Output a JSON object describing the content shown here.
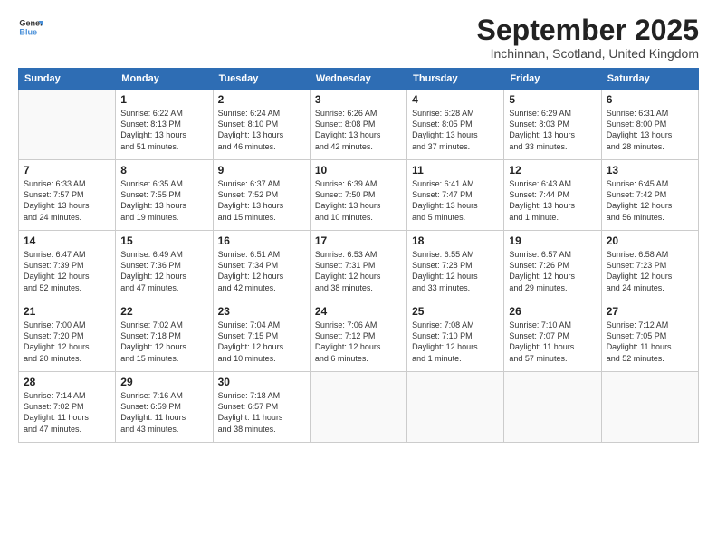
{
  "header": {
    "logo_line1": "General",
    "logo_line2": "Blue",
    "month_title": "September 2025",
    "location": "Inchinnan, Scotland, United Kingdom"
  },
  "days_of_week": [
    "Sunday",
    "Monday",
    "Tuesday",
    "Wednesday",
    "Thursday",
    "Friday",
    "Saturday"
  ],
  "weeks": [
    [
      {
        "day": "",
        "info": ""
      },
      {
        "day": "1",
        "info": "Sunrise: 6:22 AM\nSunset: 8:13 PM\nDaylight: 13 hours\nand 51 minutes."
      },
      {
        "day": "2",
        "info": "Sunrise: 6:24 AM\nSunset: 8:10 PM\nDaylight: 13 hours\nand 46 minutes."
      },
      {
        "day": "3",
        "info": "Sunrise: 6:26 AM\nSunset: 8:08 PM\nDaylight: 13 hours\nand 42 minutes."
      },
      {
        "day": "4",
        "info": "Sunrise: 6:28 AM\nSunset: 8:05 PM\nDaylight: 13 hours\nand 37 minutes."
      },
      {
        "day": "5",
        "info": "Sunrise: 6:29 AM\nSunset: 8:03 PM\nDaylight: 13 hours\nand 33 minutes."
      },
      {
        "day": "6",
        "info": "Sunrise: 6:31 AM\nSunset: 8:00 PM\nDaylight: 13 hours\nand 28 minutes."
      }
    ],
    [
      {
        "day": "7",
        "info": "Sunrise: 6:33 AM\nSunset: 7:57 PM\nDaylight: 13 hours\nand 24 minutes."
      },
      {
        "day": "8",
        "info": "Sunrise: 6:35 AM\nSunset: 7:55 PM\nDaylight: 13 hours\nand 19 minutes."
      },
      {
        "day": "9",
        "info": "Sunrise: 6:37 AM\nSunset: 7:52 PM\nDaylight: 13 hours\nand 15 minutes."
      },
      {
        "day": "10",
        "info": "Sunrise: 6:39 AM\nSunset: 7:50 PM\nDaylight: 13 hours\nand 10 minutes."
      },
      {
        "day": "11",
        "info": "Sunrise: 6:41 AM\nSunset: 7:47 PM\nDaylight: 13 hours\nand 5 minutes."
      },
      {
        "day": "12",
        "info": "Sunrise: 6:43 AM\nSunset: 7:44 PM\nDaylight: 13 hours\nand 1 minute."
      },
      {
        "day": "13",
        "info": "Sunrise: 6:45 AM\nSunset: 7:42 PM\nDaylight: 12 hours\nand 56 minutes."
      }
    ],
    [
      {
        "day": "14",
        "info": "Sunrise: 6:47 AM\nSunset: 7:39 PM\nDaylight: 12 hours\nand 52 minutes."
      },
      {
        "day": "15",
        "info": "Sunrise: 6:49 AM\nSunset: 7:36 PM\nDaylight: 12 hours\nand 47 minutes."
      },
      {
        "day": "16",
        "info": "Sunrise: 6:51 AM\nSunset: 7:34 PM\nDaylight: 12 hours\nand 42 minutes."
      },
      {
        "day": "17",
        "info": "Sunrise: 6:53 AM\nSunset: 7:31 PM\nDaylight: 12 hours\nand 38 minutes."
      },
      {
        "day": "18",
        "info": "Sunrise: 6:55 AM\nSunset: 7:28 PM\nDaylight: 12 hours\nand 33 minutes."
      },
      {
        "day": "19",
        "info": "Sunrise: 6:57 AM\nSunset: 7:26 PM\nDaylight: 12 hours\nand 29 minutes."
      },
      {
        "day": "20",
        "info": "Sunrise: 6:58 AM\nSunset: 7:23 PM\nDaylight: 12 hours\nand 24 minutes."
      }
    ],
    [
      {
        "day": "21",
        "info": "Sunrise: 7:00 AM\nSunset: 7:20 PM\nDaylight: 12 hours\nand 20 minutes."
      },
      {
        "day": "22",
        "info": "Sunrise: 7:02 AM\nSunset: 7:18 PM\nDaylight: 12 hours\nand 15 minutes."
      },
      {
        "day": "23",
        "info": "Sunrise: 7:04 AM\nSunset: 7:15 PM\nDaylight: 12 hours\nand 10 minutes."
      },
      {
        "day": "24",
        "info": "Sunrise: 7:06 AM\nSunset: 7:12 PM\nDaylight: 12 hours\nand 6 minutes."
      },
      {
        "day": "25",
        "info": "Sunrise: 7:08 AM\nSunset: 7:10 PM\nDaylight: 12 hours\nand 1 minute."
      },
      {
        "day": "26",
        "info": "Sunrise: 7:10 AM\nSunset: 7:07 PM\nDaylight: 11 hours\nand 57 minutes."
      },
      {
        "day": "27",
        "info": "Sunrise: 7:12 AM\nSunset: 7:05 PM\nDaylight: 11 hours\nand 52 minutes."
      }
    ],
    [
      {
        "day": "28",
        "info": "Sunrise: 7:14 AM\nSunset: 7:02 PM\nDaylight: 11 hours\nand 47 minutes."
      },
      {
        "day": "29",
        "info": "Sunrise: 7:16 AM\nSunset: 6:59 PM\nDaylight: 11 hours\nand 43 minutes."
      },
      {
        "day": "30",
        "info": "Sunrise: 7:18 AM\nSunset: 6:57 PM\nDaylight: 11 hours\nand 38 minutes."
      },
      {
        "day": "",
        "info": ""
      },
      {
        "day": "",
        "info": ""
      },
      {
        "day": "",
        "info": ""
      },
      {
        "day": "",
        "info": ""
      }
    ]
  ]
}
